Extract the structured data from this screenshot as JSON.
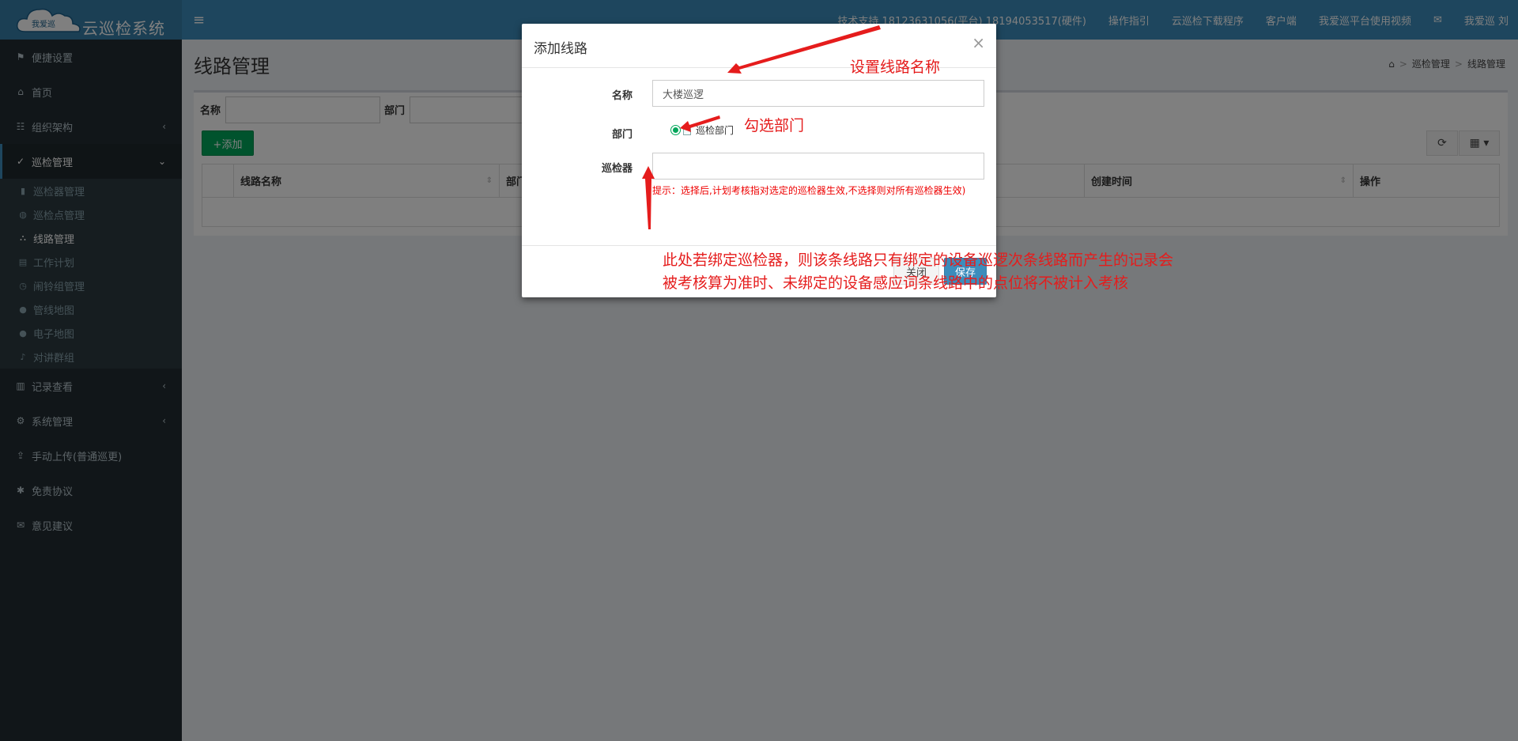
{
  "header": {
    "logo_badge": "我爱巡",
    "logo_text": "云巡检系统",
    "nav": [
      {
        "label": "技术支持 18123631056(平台) 18194053517(硬件)"
      },
      {
        "label": "操作指引"
      },
      {
        "label": "云巡检下载程序"
      },
      {
        "label": "客户端"
      },
      {
        "label": "我爱巡平台使用视频"
      },
      {
        "label": "✉"
      },
      {
        "label": "我爱巡 刘"
      }
    ]
  },
  "sidebar": {
    "items": [
      {
        "label": "便捷设置",
        "icon": "flag-icon"
      },
      {
        "label": "首页",
        "icon": "home-icon"
      },
      {
        "label": "组织架构",
        "icon": "sitemap-icon"
      },
      {
        "label": "巡检管理",
        "icon": "check-icon"
      },
      {
        "label": "记录查看",
        "icon": "chart-icon"
      },
      {
        "label": "系统管理",
        "icon": "gear-icon"
      },
      {
        "label": "手动上传(普通巡更)",
        "icon": "upload-icon"
      },
      {
        "label": "免责协议",
        "icon": "asterisk-icon"
      },
      {
        "label": "意见建议",
        "icon": "mail-icon"
      }
    ],
    "submenu": [
      {
        "label": "巡检器管理"
      },
      {
        "label": "巡检点管理"
      },
      {
        "label": "线路管理"
      },
      {
        "label": "工作计划"
      },
      {
        "label": "闹铃组管理"
      },
      {
        "label": "管线地图"
      },
      {
        "label": "电子地图"
      },
      {
        "label": "对讲群组"
      }
    ]
  },
  "page": {
    "title": "线路管理",
    "breadcrumb": [
      "巡检管理",
      "线路管理"
    ],
    "filter": {
      "name_label": "名称",
      "dept_label": "部门"
    },
    "add_label": "+添加",
    "columns": [
      "线路名称",
      "部门",
      "创建时间",
      "操作"
    ]
  },
  "modal": {
    "title": "添加线路",
    "close": "×",
    "name_label": "名称",
    "name_value": "大楼巡逻",
    "dept_label": "部门",
    "dept_option": "巡检部门",
    "device_label": "巡检器",
    "device_value": "",
    "hint": "提示：选择后,计划考核指对选定的巡检器生效,不选择则对所有巡检器生效)",
    "btn_close": "关闭",
    "btn_save": "保存"
  },
  "annotations": {
    "set_name": "设置线路名称",
    "check_dept": "勾选部门",
    "note": "此处若绑定巡检器，则该条线路只有绑定的设备巡逻次条线路而产生的记录会被考核算为准时、未绑定的设备感应词条线路中的点位将不被计入考核"
  },
  "colors": {
    "header": "#3c8dbc",
    "sidebar": "#222d32",
    "add_button": "#00a65a",
    "annotation": "#e51c1c"
  }
}
